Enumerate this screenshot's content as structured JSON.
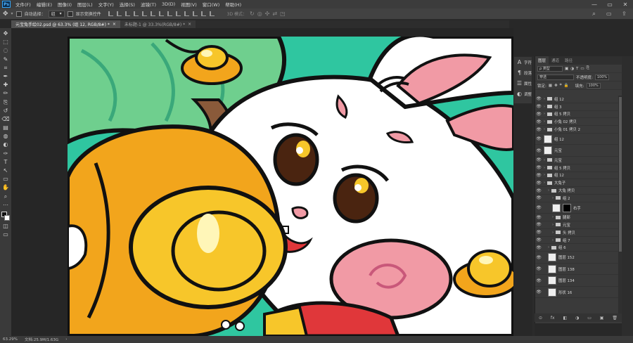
{
  "menubar": {
    "logo": "Ps",
    "items": [
      "文件(F)",
      "编辑(E)",
      "图像(I)",
      "图层(L)",
      "文字(Y)",
      "选择(S)",
      "滤镜(T)",
      "3D(D)",
      "视图(V)",
      "窗口(W)",
      "帮助(H)"
    ],
    "minimize": "—",
    "maximize": "▭",
    "close": "✕"
  },
  "options": {
    "move_icon": "✥",
    "auto_select_label": "自动选择：",
    "auto_select_value": "组",
    "show_transform_label": "显示变换控件",
    "mode_3d_label": "3D 模式："
  },
  "tabs": [
    {
      "label": "元宝兔手绘02.psd @ 63.3% (组 12, RGB/8#) *",
      "close": "×"
    },
    {
      "label": "未标题-1 @ 33.3%(RGB/8#) *",
      "close": "×"
    }
  ],
  "tools": [
    "move-icon",
    "marquee-icon",
    "lasso-icon",
    "quick-select-icon",
    "crop-icon",
    "eyedropper-icon",
    "healing-icon",
    "brush-icon",
    "stamp-icon",
    "history-brush-icon",
    "eraser-icon",
    "gradient-icon",
    "blur-icon",
    "dodge-icon",
    "pen-icon",
    "type-icon",
    "path-select-icon",
    "rectangle-icon",
    "hand-icon",
    "zoom-icon",
    "more-icon"
  ],
  "tool_glyphs": [
    "✥",
    "⬚",
    "◌",
    "✎",
    "⌗",
    "✒",
    "✚",
    "✏",
    "⎘",
    "↺",
    "⌫",
    "▤",
    "◍",
    "◐",
    "✑",
    "T",
    "↖",
    "▭",
    "✋",
    "⌕",
    "⋯"
  ],
  "icon_strip": [
    {
      "icon": "character-icon",
      "glyph": "A",
      "label": "字符"
    },
    {
      "icon": "paragraph-icon",
      "glyph": "¶",
      "label": "段落"
    },
    {
      "icon": "properties-icon",
      "glyph": "☰",
      "label": "属性"
    },
    {
      "icon": "adjustments-icon",
      "glyph": "◐",
      "label": "调整"
    }
  ],
  "layers_panel": {
    "tabs": [
      "图层",
      "通道",
      "路径"
    ],
    "kind_label": "ρ 类型",
    "blend_mode": "穿透",
    "opacity_label": "不透明度:",
    "opacity_value": "100%",
    "lock_label": "锁定:",
    "fill_label": "填充:",
    "fill_value": "100%",
    "layers": [
      {
        "name": "组 12",
        "type": "group",
        "indent": 0
      },
      {
        "name": "组 3",
        "type": "group",
        "indent": 0
      },
      {
        "name": "组 5 拷贝",
        "type": "group",
        "indent": 0
      },
      {
        "name": "小兔 02 拷贝",
        "type": "group",
        "indent": 0
      },
      {
        "name": "小兔 01 拷贝 2",
        "type": "group",
        "indent": 0
      },
      {
        "name": "组 12",
        "type": "layer",
        "indent": 0
      },
      {
        "name": "元宝",
        "type": "layer",
        "indent": 0
      },
      {
        "name": "元宝",
        "type": "group",
        "indent": 0
      },
      {
        "name": "组 5 拷贝",
        "type": "group",
        "indent": 0
      },
      {
        "name": "组 12",
        "type": "group",
        "indent": 0
      },
      {
        "name": "大兔子",
        "type": "group",
        "indent": 0
      },
      {
        "name": "大兔 拷贝",
        "type": "group",
        "indent": 1
      },
      {
        "name": "组 2",
        "type": "group",
        "indent": 2
      },
      {
        "name": "右手",
        "type": "masked",
        "indent": 2
      },
      {
        "name": "腿部",
        "type": "group",
        "indent": 2
      },
      {
        "name": "元宝",
        "type": "group",
        "indent": 2
      },
      {
        "name": "头 拷贝",
        "type": "group",
        "indent": 2
      },
      {
        "name": "组 7",
        "type": "group",
        "indent": 2
      },
      {
        "name": "组 6",
        "type": "group",
        "indent": 1
      },
      {
        "name": "图层 152",
        "type": "layer",
        "indent": 1
      },
      {
        "name": "图层 138",
        "type": "layer",
        "indent": 1
      },
      {
        "name": "图层 134",
        "type": "layer",
        "indent": 1
      },
      {
        "name": "形状 16",
        "type": "layer",
        "indent": 1
      }
    ],
    "footer": [
      "⊙",
      "fx",
      "◧",
      "◑",
      "▭",
      "▣",
      "🗑"
    ]
  },
  "status": {
    "zoom": "63.29%",
    "doc": "文档:25.9M/1.63G"
  },
  "colors": {
    "teal": "#2fc6a0",
    "green": "#6fcf8e",
    "yellow": "#f7c62a",
    "orange": "#f2a51c",
    "pink": "#f19aa5",
    "red": "#e0373a",
    "white": "#ffffff",
    "outline": "#111111"
  }
}
